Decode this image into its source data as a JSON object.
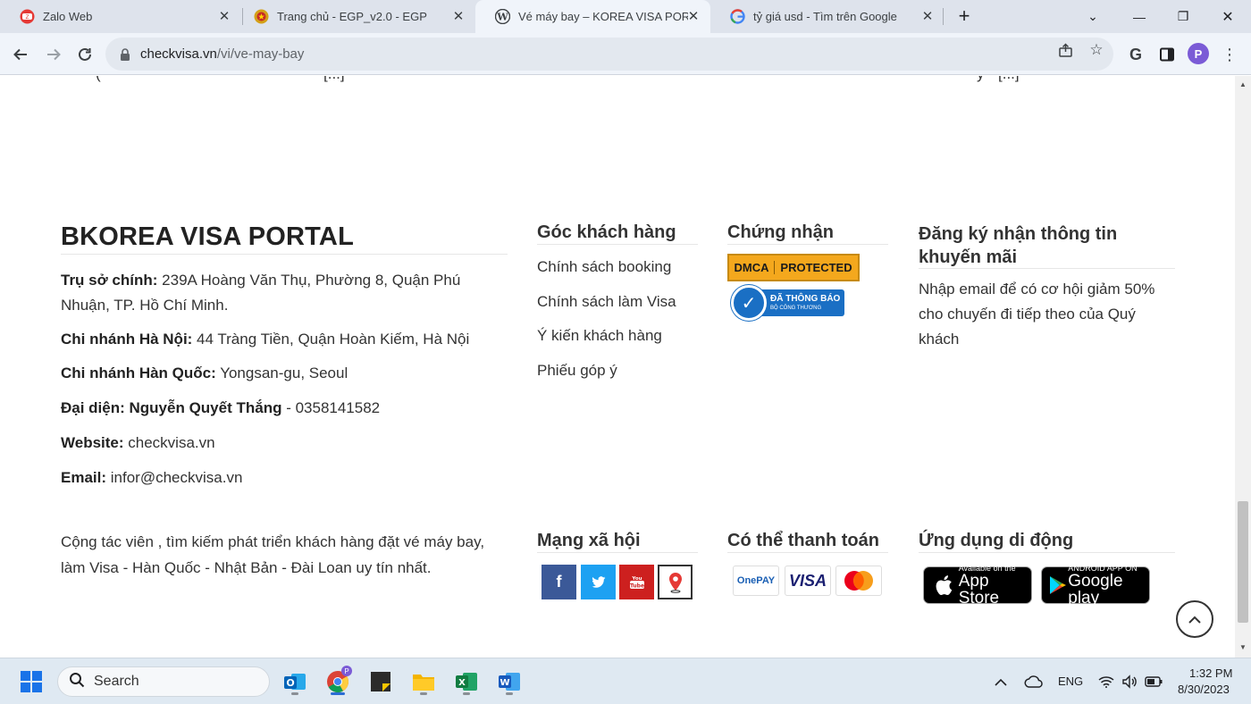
{
  "browser": {
    "tabs": [
      {
        "title": "Zalo Web",
        "icon": "zalo-icon"
      },
      {
        "title": "Trang chủ - EGP_v2.0 - EGP",
        "icon": "emblem-icon"
      },
      {
        "title": "Vé máy bay – KOREA VISA PORTAL",
        "icon": "wordpress-icon",
        "active": true
      },
      {
        "title": "tỷ giá usd - Tìm trên Google",
        "icon": "google-icon"
      }
    ],
    "url_host": "checkvisa.vn",
    "url_path": "/vi/ve-may-bay",
    "profile_initial": "P"
  },
  "page": {
    "clipped_top_left": "(",
    "clipped_top_left_mid": "[...]",
    "clipped_top_right": "y",
    "clipped_top_right_mid": "[...]",
    "brand": "BKOREA VISA PORTAL",
    "info": [
      {
        "label": "Trụ sở chính:",
        "value": " 239A Hoàng Văn Thụ, Phường 8, Quận Phú Nhuận, TP. Hồ Chí Minh."
      },
      {
        "label": "Chi nhánh Hà Nội:",
        "value": " 44 Tràng Tiền, Quận Hoàn Kiếm, Hà Nội"
      },
      {
        "label": "Chi nhánh Hàn Quốc:",
        "value": " Yongsan-gu, Seoul"
      },
      {
        "label": "Đại diện: Nguyễn Quyết Thắng",
        "value": " - 0358141582"
      },
      {
        "label": "Website:",
        "value": " checkvisa.vn"
      },
      {
        "label": "Email:",
        "value": " infor@checkvisa.vn"
      }
    ],
    "customer_corner": {
      "title": "Góc khách hàng",
      "links": [
        "Chính sách booking",
        "Chính sách làm Visa",
        "Ý kiến khách hàng",
        "Phiếu góp ý"
      ]
    },
    "certification": {
      "title": "Chứng nhận",
      "dmca_left": "DMCA",
      "dmca_right": "PROTECTED",
      "bct_line1": "ĐÃ THÔNG BÁO",
      "bct_line2": "BỘ CÔNG THƯƠNG"
    },
    "newsletter": {
      "title": "Đăng ký nhận thông tin khuyến mãi",
      "text": "Nhập email để có cơ hội giảm 50% cho chuyến đi tiếp theo của Quý khách"
    },
    "blurb": "Cộng tác viên , tìm kiếm phát triển khách hàng đặt vé máy bay, làm Visa - Hàn Quốc - Nhật Bản - Đài Loan uy tín nhất.",
    "social": {
      "title": "Mạng xã hội",
      "items": [
        "facebook-icon",
        "twitter-icon",
        "youtube-icon",
        "map-pin-icon"
      ],
      "colors": [
        "#3b5998",
        "#1da1f2",
        "#cd201f",
        "#ffffff"
      ]
    },
    "payment": {
      "title": "Có thể thanh toán",
      "items": [
        "OnePAY",
        "VISA",
        "MasterCard"
      ]
    },
    "apps": {
      "title": "Ứng dụng di động",
      "appstore_small": "Available on the",
      "appstore_big": "App Store",
      "gplay_small": "ANDROID APP ON",
      "gplay_big": "Google play"
    }
  },
  "taskbar": {
    "search_label": "Search",
    "lang": "ENG",
    "time": "1:32 PM",
    "date": "8/30/2023"
  }
}
